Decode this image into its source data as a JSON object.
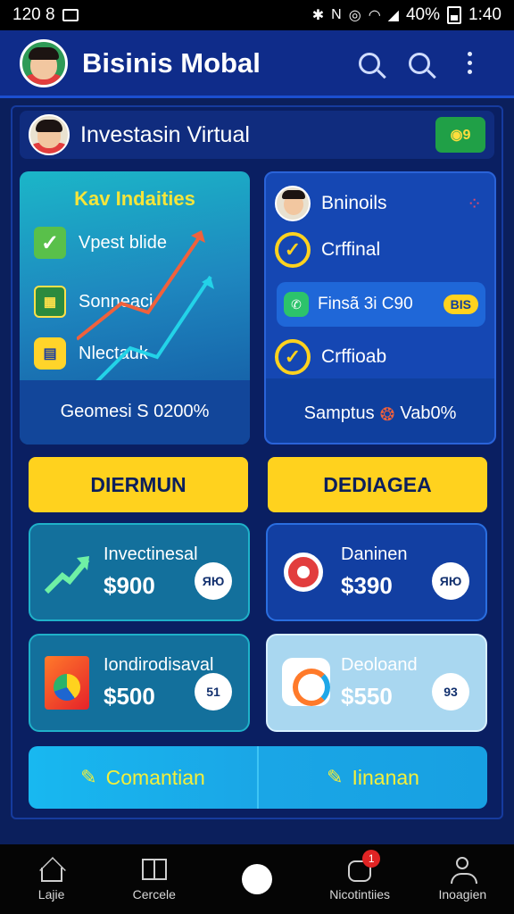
{
  "status_bar": {
    "time_left": "120 8",
    "battery_text": "40%",
    "time_right": "1:40"
  },
  "header": {
    "title": "Bisinis Mobal"
  },
  "invest_bar": {
    "title": "Investasin Virtual",
    "badge": "◉9"
  },
  "left_card": {
    "heading": "Kav Indaities",
    "items": [
      {
        "label": "Vpest blide",
        "icon": "check-icon"
      },
      {
        "label": "Sonneaci",
        "icon": "calendar-icon"
      },
      {
        "label": "Nlectauk",
        "icon": "ledger-icon"
      }
    ],
    "footer": "Geomesi S 0200%"
  },
  "right_card": {
    "items": [
      {
        "label": "Bninoils",
        "icon": "avatar"
      },
      {
        "label": "Crffinal",
        "icon": "check-circle-icon"
      },
      {
        "label": "Crffioab",
        "icon": "check-circle-icon"
      }
    ],
    "fiscal": {
      "label": "Finsã 3i C90",
      "chip": "BIS"
    },
    "footer_left": "Samptus",
    "footer_right": "Vab0%"
  },
  "cta": {
    "left": "DIERMUN",
    "right": "DEDIAGEA"
  },
  "money_cards": [
    {
      "label": "Invectinesal",
      "amount": "$900",
      "chip": "ЯЮ",
      "icon": "trend-up-icon"
    },
    {
      "label": "Daninen",
      "amount": "$390",
      "chip": "ЯЮ",
      "icon": "target-icon"
    },
    {
      "label": "Iondirodisaval",
      "amount": "$500",
      "chip": "51",
      "icon": "pie-chart-icon"
    },
    {
      "label": "Deoloand",
      "amount": "$550",
      "chip": "93",
      "icon": "app-gear-icon"
    }
  ],
  "bottom_banner": {
    "left": "Comantian",
    "right": "Iinanan"
  },
  "nav": {
    "items": [
      {
        "label": "Lajie",
        "icon": "home-icon"
      },
      {
        "label": "Cercele",
        "icon": "book-icon"
      },
      {
        "label": "",
        "icon": "home-button"
      },
      {
        "label": "Nicotintiies",
        "icon": "bell-icon",
        "badge": "1"
      },
      {
        "label": "Inoagien",
        "icon": "person-icon"
      }
    ]
  },
  "colors": {
    "background": "#0b1f5c",
    "accent_yellow": "#ffd21e",
    "app_bar": "#0f2c8a"
  }
}
